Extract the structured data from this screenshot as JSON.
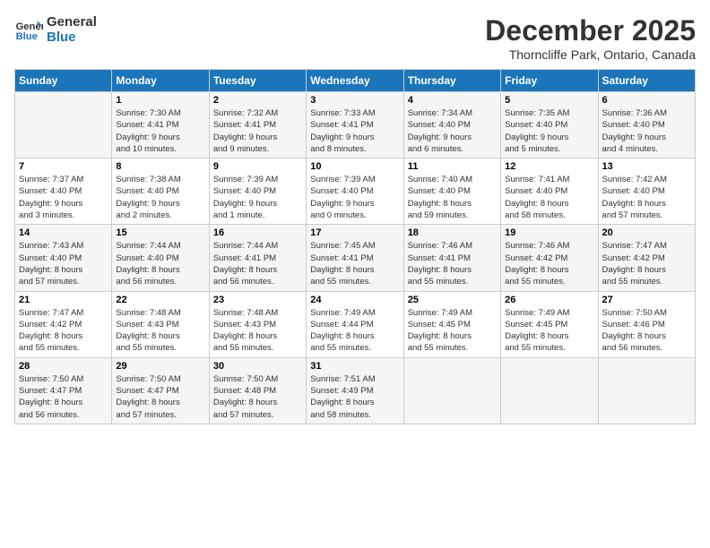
{
  "logo": {
    "line1": "General",
    "line2": "Blue"
  },
  "title": "December 2025",
  "subtitle": "Thorncliffe Park, Ontario, Canada",
  "headers": [
    "Sunday",
    "Monday",
    "Tuesday",
    "Wednesday",
    "Thursday",
    "Friday",
    "Saturday"
  ],
  "rows": [
    [
      {
        "num": "",
        "info": ""
      },
      {
        "num": "1",
        "info": "Sunrise: 7:30 AM\nSunset: 4:41 PM\nDaylight: 9 hours\nand 10 minutes."
      },
      {
        "num": "2",
        "info": "Sunrise: 7:32 AM\nSunset: 4:41 PM\nDaylight: 9 hours\nand 9 minutes."
      },
      {
        "num": "3",
        "info": "Sunrise: 7:33 AM\nSunset: 4:41 PM\nDaylight: 9 hours\nand 8 minutes."
      },
      {
        "num": "4",
        "info": "Sunrise: 7:34 AM\nSunset: 4:40 PM\nDaylight: 9 hours\nand 6 minutes."
      },
      {
        "num": "5",
        "info": "Sunrise: 7:35 AM\nSunset: 4:40 PM\nDaylight: 9 hours\nand 5 minutes."
      },
      {
        "num": "6",
        "info": "Sunrise: 7:36 AM\nSunset: 4:40 PM\nDaylight: 9 hours\nand 4 minutes."
      }
    ],
    [
      {
        "num": "7",
        "info": "Sunrise: 7:37 AM\nSunset: 4:40 PM\nDaylight: 9 hours\nand 3 minutes."
      },
      {
        "num": "8",
        "info": "Sunrise: 7:38 AM\nSunset: 4:40 PM\nDaylight: 9 hours\nand 2 minutes."
      },
      {
        "num": "9",
        "info": "Sunrise: 7:39 AM\nSunset: 4:40 PM\nDaylight: 9 hours\nand 1 minute."
      },
      {
        "num": "10",
        "info": "Sunrise: 7:39 AM\nSunset: 4:40 PM\nDaylight: 9 hours\nand 0 minutes."
      },
      {
        "num": "11",
        "info": "Sunrise: 7:40 AM\nSunset: 4:40 PM\nDaylight: 8 hours\nand 59 minutes."
      },
      {
        "num": "12",
        "info": "Sunrise: 7:41 AM\nSunset: 4:40 PM\nDaylight: 8 hours\nand 58 minutes."
      },
      {
        "num": "13",
        "info": "Sunrise: 7:42 AM\nSunset: 4:40 PM\nDaylight: 8 hours\nand 57 minutes."
      }
    ],
    [
      {
        "num": "14",
        "info": "Sunrise: 7:43 AM\nSunset: 4:40 PM\nDaylight: 8 hours\nand 57 minutes."
      },
      {
        "num": "15",
        "info": "Sunrise: 7:44 AM\nSunset: 4:40 PM\nDaylight: 8 hours\nand 56 minutes."
      },
      {
        "num": "16",
        "info": "Sunrise: 7:44 AM\nSunset: 4:41 PM\nDaylight: 8 hours\nand 56 minutes."
      },
      {
        "num": "17",
        "info": "Sunrise: 7:45 AM\nSunset: 4:41 PM\nDaylight: 8 hours\nand 55 minutes."
      },
      {
        "num": "18",
        "info": "Sunrise: 7:46 AM\nSunset: 4:41 PM\nDaylight: 8 hours\nand 55 minutes."
      },
      {
        "num": "19",
        "info": "Sunrise: 7:46 AM\nSunset: 4:42 PM\nDaylight: 8 hours\nand 55 minutes."
      },
      {
        "num": "20",
        "info": "Sunrise: 7:47 AM\nSunset: 4:42 PM\nDaylight: 8 hours\nand 55 minutes."
      }
    ],
    [
      {
        "num": "21",
        "info": "Sunrise: 7:47 AM\nSunset: 4:42 PM\nDaylight: 8 hours\nand 55 minutes."
      },
      {
        "num": "22",
        "info": "Sunrise: 7:48 AM\nSunset: 4:43 PM\nDaylight: 8 hours\nand 55 minutes."
      },
      {
        "num": "23",
        "info": "Sunrise: 7:48 AM\nSunset: 4:43 PM\nDaylight: 8 hours\nand 55 minutes."
      },
      {
        "num": "24",
        "info": "Sunrise: 7:49 AM\nSunset: 4:44 PM\nDaylight: 8 hours\nand 55 minutes."
      },
      {
        "num": "25",
        "info": "Sunrise: 7:49 AM\nSunset: 4:45 PM\nDaylight: 8 hours\nand 55 minutes."
      },
      {
        "num": "26",
        "info": "Sunrise: 7:49 AM\nSunset: 4:45 PM\nDaylight: 8 hours\nand 55 minutes."
      },
      {
        "num": "27",
        "info": "Sunrise: 7:50 AM\nSunset: 4:46 PM\nDaylight: 8 hours\nand 56 minutes."
      }
    ],
    [
      {
        "num": "28",
        "info": "Sunrise: 7:50 AM\nSunset: 4:47 PM\nDaylight: 8 hours\nand 56 minutes."
      },
      {
        "num": "29",
        "info": "Sunrise: 7:50 AM\nSunset: 4:47 PM\nDaylight: 8 hours\nand 57 minutes."
      },
      {
        "num": "30",
        "info": "Sunrise: 7:50 AM\nSunset: 4:48 PM\nDaylight: 8 hours\nand 57 minutes."
      },
      {
        "num": "31",
        "info": "Sunrise: 7:51 AM\nSunset: 4:49 PM\nDaylight: 8 hours\nand 58 minutes."
      },
      {
        "num": "",
        "info": ""
      },
      {
        "num": "",
        "info": ""
      },
      {
        "num": "",
        "info": ""
      }
    ]
  ]
}
